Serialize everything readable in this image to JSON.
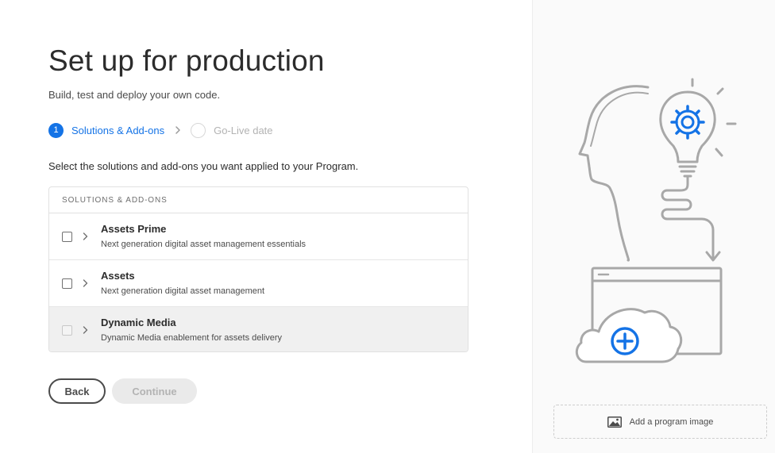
{
  "page": {
    "title": "Set up for production",
    "subtitle": "Build, test and deploy your own code."
  },
  "steps": [
    {
      "number": "1",
      "label": "Solutions & Add-ons",
      "state": "active"
    },
    {
      "number": "",
      "label": "Go-Live date",
      "state": "inactive"
    }
  ],
  "instructions": "Select the solutions and add-ons you want applied to your Program.",
  "table": {
    "header": "SOLUTIONS & ADD-ONS",
    "rows": [
      {
        "name": "Assets Prime",
        "description": "Next generation digital asset management essentials",
        "checked": false,
        "disabled": false
      },
      {
        "name": "Assets",
        "description": "Next generation digital asset management",
        "checked": false,
        "disabled": false
      },
      {
        "name": "Dynamic Media",
        "description": "Dynamic Media enablement for assets delivery",
        "checked": false,
        "disabled": true
      }
    ]
  },
  "buttons": {
    "back": "Back",
    "continue": "Continue"
  },
  "side_panel": {
    "add_image_label": "Add a program image",
    "icon": "image-icon"
  },
  "colors": {
    "accent": "#1473e6",
    "illustration_stroke": "#a8a8a8"
  }
}
